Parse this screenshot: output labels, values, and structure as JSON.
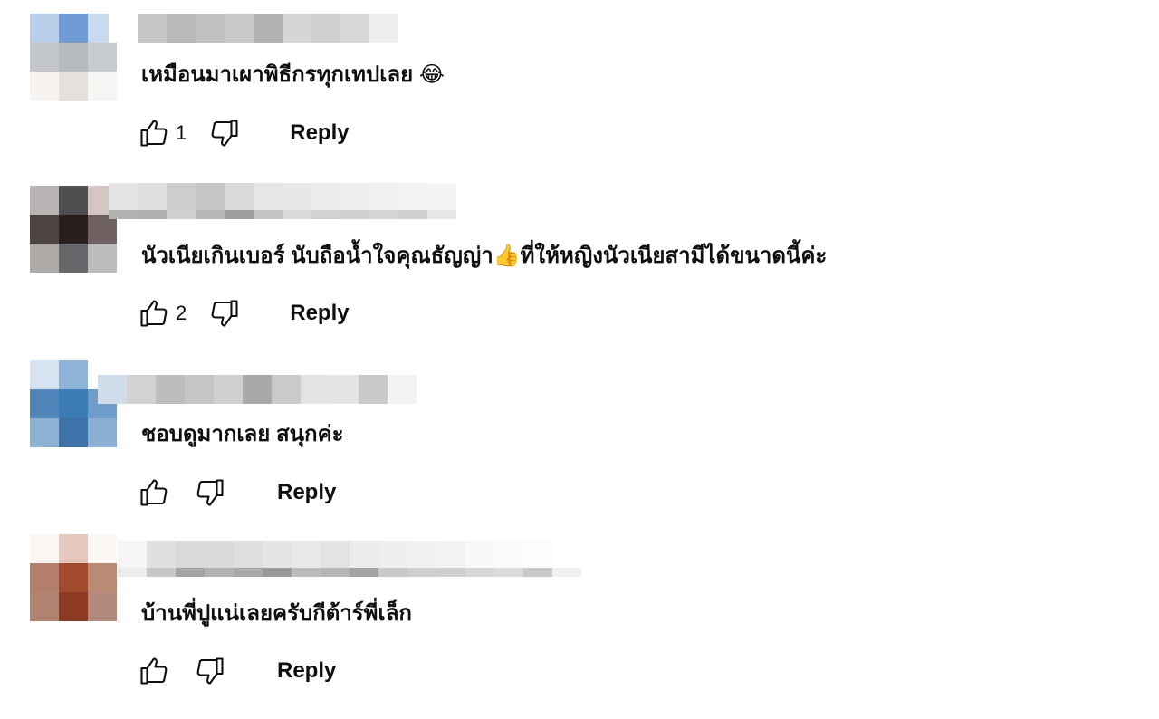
{
  "comments": [
    {
      "text": "เหมือนมาเผาพิธีกรทุกเทปเลย 😂",
      "likes": "1",
      "reply_label": "Reply",
      "avatar_pixels": [
        "#b9cfe9",
        "#6e9ad6",
        "#c9dbf1",
        "#c3c6ca",
        "#b6bbbe",
        "#c7cbcd",
        "#f6f3f0",
        "#e4e0dc",
        "#f7f5f3"
      ],
      "author_pixels": [
        "#ffffff",
        "#c6c6c6",
        "#b9b9b9",
        "#c1c1c1",
        "#c8c8c8",
        "#b1b1b1",
        "#d6d6d6",
        "#cfcfcf",
        "#d7d7d7",
        "#efefef"
      ]
    },
    {
      "text": "นัวเนียเกินเบอร์ นับถือน้ำใจคุณธัญญ่า👍ที่ให้หญิงนัวเนียสามีได้ขนาดนี้ค่ะ",
      "likes": "2",
      "reply_label": "Reply",
      "avatar_pixels": [
        "#b8b4b4",
        "#4e4e50",
        "#d5c5c3",
        "#4e4442",
        "#2a1f1d",
        "#6f6161",
        "#aeaaa8",
        "#66666b",
        "#bdbdbf"
      ],
      "author_top": [
        "#e3e3e3",
        "#dedede",
        "#cdcdcd",
        "#c7c7c7",
        "#d9d9d9",
        "#e6e6e6",
        "#e7e7e7",
        "#ececec",
        "#efefef",
        "#f1f1f1",
        "#f2f2f2",
        "#f4f4f4"
      ],
      "author_bot": [
        "#b3b3b3",
        "#b0b0b0",
        "#cfcfcf",
        "#b8b8b8",
        "#9f9f9f",
        "#c3c3c3",
        "#dadada",
        "#d2d2d2",
        "#d0d0d0",
        "#d5d5d5",
        "#cfcfcf",
        "#e6e6e6"
      ]
    },
    {
      "text": "ชอบดูมากเลย สนุกค่ะ",
      "likes": "",
      "reply_label": "Reply",
      "avatar_pixels": [
        "#d6e3f0",
        "#8fb3d7",
        "#ffffff",
        "#4f86ba",
        "#3c7bb4",
        "#6f9dc9",
        "#8db2d4",
        "#3d73a8",
        "#8cb0d3"
      ],
      "author_pixels": [
        "#d0dcea",
        "#d2d2d2",
        "#bdbdbd",
        "#c6c6c6",
        "#d0d0d0",
        "#a9a9a9",
        "#cacaca",
        "#e3e3e3",
        "#e5e5e5",
        "#c9c9c9",
        "#f2f2f2"
      ]
    },
    {
      "text": "บ้านพี่ปูแน่เลยครับกีต้าร์พี่เล็ก",
      "likes": "",
      "reply_label": "Reply",
      "avatar_pixels": [
        "#f9f6f4",
        "#e4c8bd",
        "#fbf8f6",
        "#b47f6b",
        "#a14a2e",
        "#b98a74",
        "#b28573",
        "#8d3a22",
        "#b38a7b"
      ],
      "author_top": [
        "#f5f5f5",
        "#e0e0e0",
        "#d9d9d9",
        "#dadada",
        "#dedede",
        "#e4e4e4",
        "#e8e8e8",
        "#e3e3e3",
        "#ececec",
        "#efefef",
        "#f1f1f1",
        "#f3f3f3",
        "#f8f8f8",
        "#fafafa",
        "#fcfcfc",
        "#ffffff"
      ],
      "author_bot": [
        "#ececec",
        "#c7c7c7",
        "#a4a4a4",
        "#b2b2b2",
        "#a9a9a9",
        "#9a9a9a",
        "#bcbcbc",
        "#b6b6b6",
        "#a3a3a3",
        "#c9c9c9",
        "#cfcfcf",
        "#d0d0d0",
        "#d7d7d7",
        "#dbdbdb",
        "#c9c9c9",
        "#f1f1f1"
      ]
    }
  ]
}
